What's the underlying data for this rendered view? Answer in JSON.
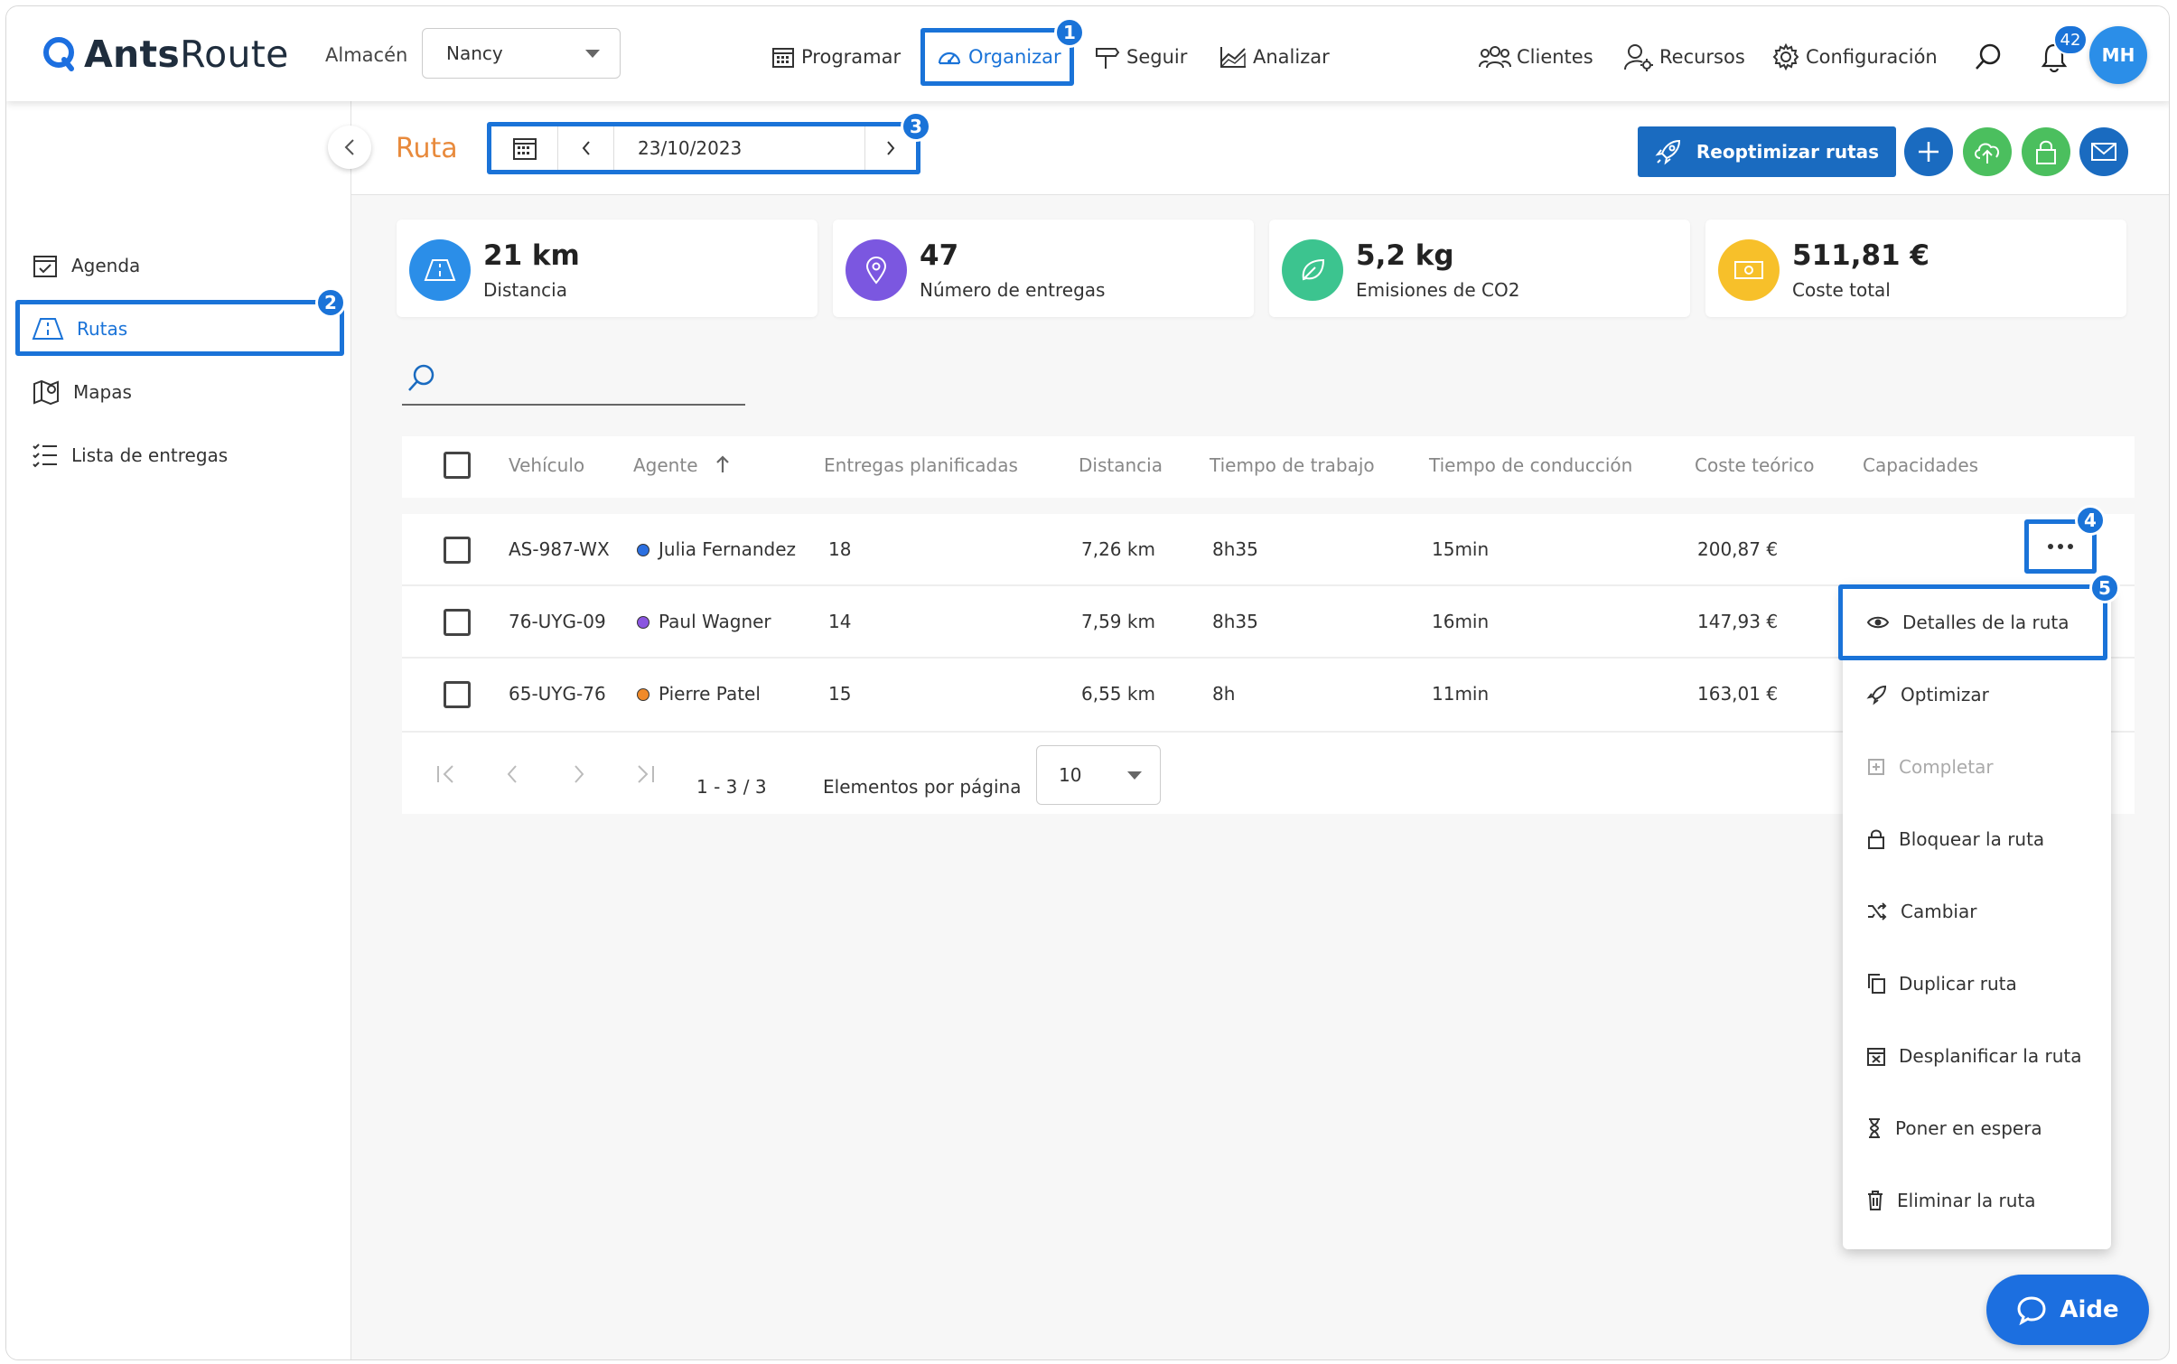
{
  "header": {
    "logo_prefix": "Ants",
    "logo_suffix": "Route",
    "warehouse_label": "Almacén",
    "warehouse_value": "Nancy",
    "nav": {
      "programar": "Programar",
      "organizar": "Organizar",
      "seguir": "Seguir",
      "analizar": "Analizar",
      "clientes": "Clientes",
      "recursos": "Recursos",
      "configuracion": "Configuración"
    },
    "notifications_count": "42",
    "avatar_initials": "MH"
  },
  "sidebar": {
    "items": [
      {
        "label": "Agenda"
      },
      {
        "label": "Rutas"
      },
      {
        "label": "Mapas"
      },
      {
        "label": "Lista de entregas"
      }
    ]
  },
  "topbar": {
    "title": "Ruta",
    "date": "23/10/2023",
    "reoptimize_label": "Reoptimizar rutas"
  },
  "stats": [
    {
      "value": "21 km",
      "label": "Distancia",
      "color": "#2b8ee8"
    },
    {
      "value": "47",
      "label": "Número de entregas",
      "color": "#7b57e0"
    },
    {
      "value": "5,2 kg",
      "label": "Emisiones de CO2",
      "color": "#3cc48f"
    },
    {
      "value": "511,81 €",
      "label": "Coste total",
      "color": "#f7c02a"
    }
  ],
  "table": {
    "headers": {
      "vehicle": "Vehículo",
      "agent": "Agente",
      "planned": "Entregas planificadas",
      "distance": "Distancia",
      "work_time": "Tiempo de trabajo",
      "drive_time": "Tiempo de conducción",
      "cost": "Coste teórico",
      "capacities": "Capacidades"
    },
    "rows": [
      {
        "vehicle": "AS-987-WX",
        "agent": "Julia Fernandez",
        "agent_color": "#2b6fe0",
        "planned": "18",
        "distance": "7,26 km",
        "work_time": "8h35",
        "drive_time": "15min",
        "cost": "200,87 €"
      },
      {
        "vehicle": "76-UYG-09",
        "agent": "Paul Wagner",
        "agent_color": "#8a55e0",
        "planned": "14",
        "distance": "7,59 km",
        "work_time": "8h35",
        "drive_time": "16min",
        "cost": "147,93 €"
      },
      {
        "vehicle": "65-UYG-76",
        "agent": "Pierre Patel",
        "agent_color": "#f08a2a",
        "planned": "15",
        "distance": "6,55 km",
        "work_time": "8h",
        "drive_time": "11min",
        "cost": "163,01 €"
      }
    ],
    "pagination": {
      "range": "1 - 3 / 3",
      "per_page_label": "Elementos por página",
      "per_page_value": "10"
    }
  },
  "context_menu": {
    "items": [
      {
        "label": "Detalles de la ruta",
        "icon": "eye-icon"
      },
      {
        "label": "Optimizar",
        "icon": "rocket-icon"
      },
      {
        "label": "Completar",
        "icon": "complete-icon"
      },
      {
        "label": "Bloquear la ruta",
        "icon": "lock-icon"
      },
      {
        "label": "Cambiar",
        "icon": "shuffle-icon"
      },
      {
        "label": "Duplicar ruta",
        "icon": "copy-icon"
      },
      {
        "label": "Desplanificar la ruta",
        "icon": "unplan-icon"
      },
      {
        "label": "Poner en espera",
        "icon": "hourglass-icon"
      },
      {
        "label": "Eliminar la ruta",
        "icon": "trash-icon"
      }
    ]
  },
  "steps": [
    "1",
    "2",
    "3",
    "4",
    "5"
  ],
  "help_label": "Aide",
  "colors": {
    "accent": "#1a73d8",
    "title": "#e88a3c"
  }
}
